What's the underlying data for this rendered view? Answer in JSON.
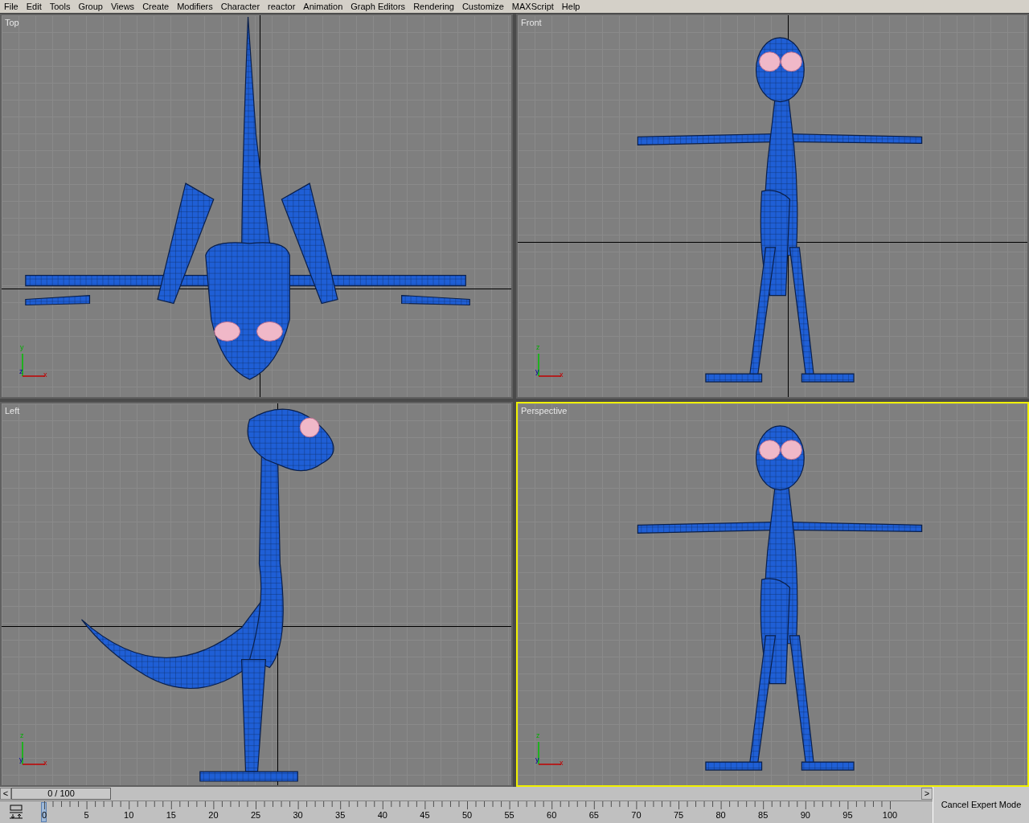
{
  "menu": [
    "File",
    "Edit",
    "Tools",
    "Group",
    "Views",
    "Create",
    "Modifiers",
    "Character",
    "reactor",
    "Animation",
    "Graph Editors",
    "Rendering",
    "Customize",
    "MAXScript",
    "Help"
  ],
  "viewports": [
    {
      "label": "Top",
      "kind": "top",
      "selected": false,
      "axes": [
        {
          "label": "y",
          "kind": "up"
        },
        {
          "label": "z",
          "kind": "origin"
        },
        {
          "label": "x",
          "kind": "right"
        }
      ]
    },
    {
      "label": "Front",
      "kind": "front",
      "selected": false,
      "axes": [
        {
          "label": "z",
          "kind": "up"
        },
        {
          "label": "y",
          "kind": "origin"
        },
        {
          "label": "x",
          "kind": "right"
        }
      ]
    },
    {
      "label": "Left",
      "kind": "left",
      "selected": false,
      "axes": [
        {
          "label": "z",
          "kind": "up"
        },
        {
          "label": "y",
          "kind": "origin"
        },
        {
          "label": "x",
          "kind": "right"
        }
      ]
    },
    {
      "label": "Perspective",
      "kind": "perspective",
      "selected": true,
      "axes": [
        {
          "label": "z",
          "kind": "up"
        },
        {
          "label": "y",
          "kind": "origin"
        },
        {
          "label": "x",
          "kind": "right"
        }
      ]
    }
  ],
  "timeline": {
    "prev": "<",
    "frame": "0 / 100",
    "level": 0,
    "next": ">",
    "ticks": [
      "0",
      "5",
      "10",
      "15",
      "20",
      "25",
      "30",
      "35",
      "40",
      "45",
      "50",
      "55",
      "60",
      "65",
      "70",
      "75",
      "80",
      "85",
      "90",
      "95",
      "100"
    ]
  },
  "cancel_button": "Cancel Expert Mode"
}
